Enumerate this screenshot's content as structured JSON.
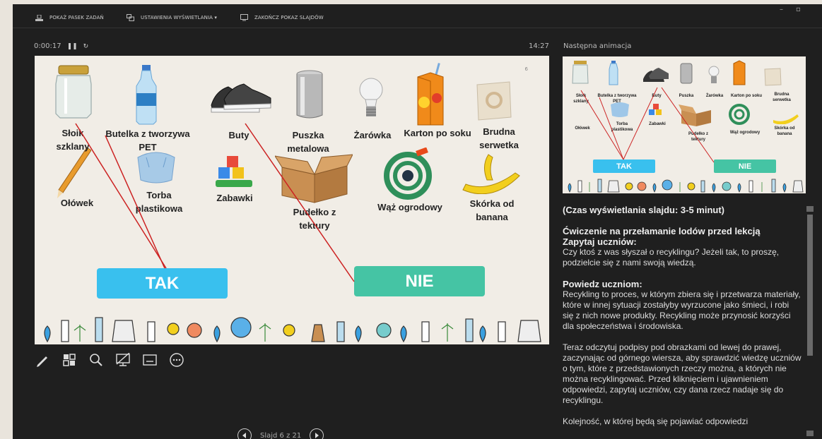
{
  "toolbar": {
    "taskbar_label": "POKAŻ PASEK ZADAŃ",
    "display_settings_label": "USTAWIENIA WYŚWIETLANIA ▾",
    "end_show_label": "ZAKOŃCZ POKAZ SLAJDÓW",
    "minimize": "–",
    "restore": "▫"
  },
  "presenter": {
    "elapsed": "0:00:17",
    "pause_icon": "pause-icon",
    "restart_icon": "restart-icon",
    "clock": "14:27",
    "next_label": "Następna animacja",
    "slide_counter": "Slajd 6 z 21"
  },
  "slide": {
    "number": "6",
    "items": [
      {
        "label": "Słoik\nszklany"
      },
      {
        "label": "Butelka z tworzywa\nPET"
      },
      {
        "label": "Buty"
      },
      {
        "label": "Puszka\nmetalowa"
      },
      {
        "label": "Żarówka"
      },
      {
        "label": "Karton po soku"
      },
      {
        "label": "Brudna\nserwetka"
      },
      {
        "label": "Ołówek"
      },
      {
        "label": "Torba\nplastikowa"
      },
      {
        "label": "Zabawki"
      },
      {
        "label": "Pudełko z\ntektury"
      },
      {
        "label": "Wąż ogrodowy"
      },
      {
        "label": "Skórka od\nbanana"
      }
    ],
    "yes_button": "TAK",
    "no_button": "NIE"
  },
  "preview": {
    "items": [
      "Słoik\nszklany",
      "Butelka z tworzywa\nPET",
      "Buty",
      "Puszka",
      "Żarówka",
      "Karton po soku",
      "Brudna\nserwetka",
      "Ołówek",
      "Torba\nplastikowa",
      "Zabawki",
      "Pudełko z\ntektury",
      "Wąż ogrodowy",
      "Skórka od\nbanana"
    ],
    "yes_button": "TAK",
    "no_button": "NIE"
  },
  "notes": {
    "p1": "(Czas wyświetlania slajdu: 3-5 minut)",
    "h2": "Ćwiczenie na przełamanie lodów przed lekcją",
    "h3": "Zapytaj uczniów:",
    "p3": "Czy ktoś z was słyszał o recyklingu? Jeżeli tak, to proszę, podzielcie się z nami swoją wiedzą.",
    "h4": "Powiedz uczniom:",
    "p4": "Recykling to proces, w którym zbiera się i przetwarza materiały, które w innej sytuacji zostałyby wyrzucone jako śmieci, i robi się z nich nowe produkty. Recykling może przynosić korzyści dla społeczeństwa i środowiska.",
    "p5": "Teraz odczytuj podpisy pod obrazkami od lewej do prawej, zaczynając od górnego wiersza, aby sprawdzić wiedzę uczniów o tym, które z przedstawionych rzeczy można, a których nie można recyklingować. Przed kliknięciem i ujawnieniem odpowiedzi, zapytaj uczniów, czy dana rzecz nadaje się do recyklingu.",
    "p6": "Kolejność, w której będą się pojawiać odpowiedzi"
  },
  "colors": {
    "yes": "#39c0ee",
    "no": "#45c4a4",
    "line": "#cc2222",
    "panel": "#1f1f1f"
  }
}
